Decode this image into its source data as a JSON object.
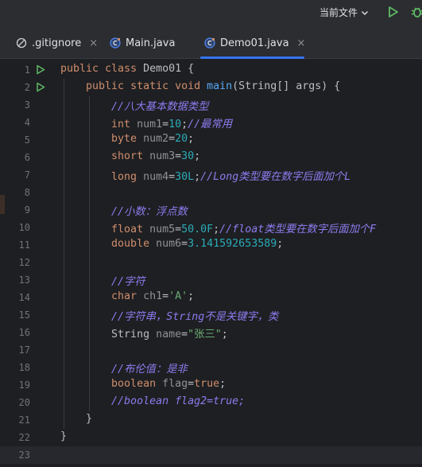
{
  "toolbar": {
    "run_config_label": "当前文件",
    "run_config_icon": "chevron-down-icon",
    "run_icon": "play-icon",
    "debug_icon": "debug-bug-icon"
  },
  "tabs": [
    {
      "label": ".gitignore",
      "icon": "ignore-file-icon",
      "active": false,
      "closable": true
    },
    {
      "label": "Main.java",
      "icon": "java-class-icon",
      "active": false,
      "closable": false
    },
    {
      "label": "Demo01.java",
      "icon": "java-class-icon",
      "active": true,
      "closable": true
    }
  ],
  "tab_close_glyph": "×",
  "colors": {
    "background": "#1e1f22",
    "keyword": "#cf8e6d",
    "method": "#56a8f5",
    "number": "#2aacb8",
    "string": "#6aab73",
    "comment": "#8c7cf0",
    "accent": "#3574f0",
    "run": "#5fb865"
  },
  "editor": {
    "current_line": 23,
    "run_gutter_lines": [
      1,
      2
    ],
    "lines": [
      {
        "n": "1",
        "tokens": [
          {
            "t": "public ",
            "c": "kw"
          },
          {
            "t": "class ",
            "c": "kw"
          },
          {
            "t": "Demo01 {",
            "c": "var"
          }
        ]
      },
      {
        "n": "2",
        "tokens": [
          {
            "t": "    public ",
            "c": "kw"
          },
          {
            "t": "static ",
            "c": "kw"
          },
          {
            "t": "void ",
            "c": "kw"
          },
          {
            "t": "main",
            "c": "fn"
          },
          {
            "t": "(String[] args) {",
            "c": "var"
          }
        ]
      },
      {
        "n": "3",
        "tokens": [
          {
            "t": "        //八大基本数据类型",
            "c": "cmt"
          }
        ]
      },
      {
        "n": "4",
        "tokens": [
          {
            "t": "        int ",
            "c": "kw"
          },
          {
            "t": "num1",
            "c": "unused"
          },
          {
            "t": "=",
            "c": "var"
          },
          {
            "t": "10",
            "c": "num"
          },
          {
            "t": ";",
            "c": "var"
          },
          {
            "t": "//最常用",
            "c": "cmt"
          }
        ]
      },
      {
        "n": "5",
        "tokens": [
          {
            "t": "        byte ",
            "c": "kw"
          },
          {
            "t": "num2",
            "c": "unused"
          },
          {
            "t": "=",
            "c": "var"
          },
          {
            "t": "20",
            "c": "num"
          },
          {
            "t": ";",
            "c": "var"
          }
        ]
      },
      {
        "n": "6",
        "tokens": [
          {
            "t": "        short ",
            "c": "kw"
          },
          {
            "t": "num3",
            "c": "unused"
          },
          {
            "t": "=",
            "c": "var"
          },
          {
            "t": "30",
            "c": "num"
          },
          {
            "t": ";",
            "c": "var"
          }
        ]
      },
      {
        "n": "7",
        "tokens": [
          {
            "t": "        long ",
            "c": "kw"
          },
          {
            "t": "num4",
            "c": "unused"
          },
          {
            "t": "=",
            "c": "var"
          },
          {
            "t": "30L",
            "c": "num"
          },
          {
            "t": ";",
            "c": "var"
          },
          {
            "t": "//Long类型要在数字后面加个L",
            "c": "cmt"
          }
        ]
      },
      {
        "n": "8",
        "tokens": []
      },
      {
        "n": "9",
        "tokens": [
          {
            "t": "        //小数：浮点数",
            "c": "cmt"
          }
        ]
      },
      {
        "n": "10",
        "tokens": [
          {
            "t": "        float ",
            "c": "kw"
          },
          {
            "t": "num5",
            "c": "unused"
          },
          {
            "t": "=",
            "c": "var"
          },
          {
            "t": "50.0F",
            "c": "num"
          },
          {
            "t": ";",
            "c": "var"
          },
          {
            "t": "//float类型要在数字后面加个F",
            "c": "cmt"
          }
        ]
      },
      {
        "n": "11",
        "tokens": [
          {
            "t": "        double ",
            "c": "kw"
          },
          {
            "t": "num6",
            "c": "unused"
          },
          {
            "t": "=",
            "c": "var"
          },
          {
            "t": "3.141592653589",
            "c": "num"
          },
          {
            "t": ";",
            "c": "var"
          }
        ]
      },
      {
        "n": "12",
        "tokens": []
      },
      {
        "n": "13",
        "tokens": [
          {
            "t": "        //字符",
            "c": "cmt"
          }
        ]
      },
      {
        "n": "14",
        "tokens": [
          {
            "t": "        char ",
            "c": "kw"
          },
          {
            "t": "ch1",
            "c": "unused"
          },
          {
            "t": "=",
            "c": "var"
          },
          {
            "t": "'A'",
            "c": "str"
          },
          {
            "t": ";",
            "c": "var"
          }
        ]
      },
      {
        "n": "15",
        "tokens": [
          {
            "t": "        //字符串，String不是关键字，类",
            "c": "cmt"
          }
        ]
      },
      {
        "n": "16",
        "tokens": [
          {
            "t": "        String ",
            "c": "var"
          },
          {
            "t": "name",
            "c": "unused"
          },
          {
            "t": "=",
            "c": "var"
          },
          {
            "t": "\"张三\"",
            "c": "str"
          },
          {
            "t": ";",
            "c": "var"
          }
        ]
      },
      {
        "n": "17",
        "tokens": []
      },
      {
        "n": "18",
        "tokens": [
          {
            "t": "        //布伦值：是非",
            "c": "cmt"
          }
        ]
      },
      {
        "n": "19",
        "tokens": [
          {
            "t": "        boolean ",
            "c": "kw"
          },
          {
            "t": "flag",
            "c": "unused"
          },
          {
            "t": "=",
            "c": "var"
          },
          {
            "t": "true",
            "c": "kw"
          },
          {
            "t": ";",
            "c": "var"
          }
        ]
      },
      {
        "n": "20",
        "tokens": [
          {
            "t": "        //boolean flag2=true;",
            "c": "cmt"
          }
        ]
      },
      {
        "n": "21",
        "tokens": [
          {
            "t": "    }",
            "c": "var"
          }
        ]
      },
      {
        "n": "22",
        "tokens": [
          {
            "t": "}",
            "c": "var"
          }
        ]
      },
      {
        "n": "23",
        "tokens": []
      }
    ]
  }
}
